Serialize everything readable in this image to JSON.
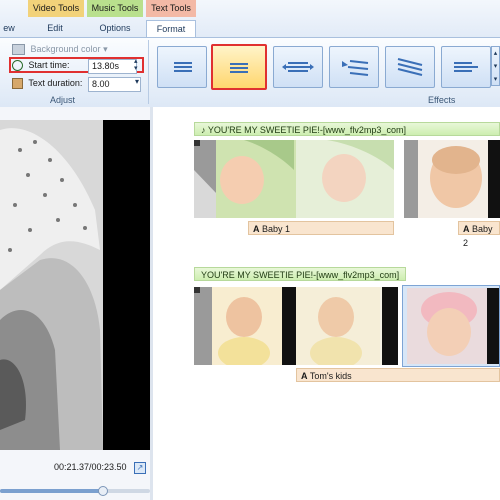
{
  "ribbon": {
    "context_tabs": [
      "Video Tools",
      "Music Tools",
      "Text Tools"
    ],
    "tabs": [
      "ew",
      "Edit",
      "Options",
      "Format"
    ],
    "adjust": {
      "background_color_label": "Background color",
      "start_time_label": "Start time:",
      "start_time_value": "13.80s",
      "text_duration_label": "Text duration:",
      "text_duration_value": "8.00",
      "group_label": "Adjust"
    },
    "effects_group_label": "Effects"
  },
  "preview": {
    "time": "00:21.37/00:23.50"
  },
  "storyboard": {
    "track1_title": "YOU'RE MY SWEETIE PIE!-[www_flv2mp3_com]",
    "track1_captions": [
      "Baby 1",
      "Baby 2"
    ],
    "track2_title": "YOU'RE MY SWEETIE PIE!-[www_flv2mp3_com]",
    "track2_caption": "Tom's kids"
  },
  "colors": {
    "highlight": "#e03030",
    "ribbon_blue": "#dde8f6",
    "green_bar": "#cdeeb0",
    "caption_tan": "#f9e5cf"
  }
}
